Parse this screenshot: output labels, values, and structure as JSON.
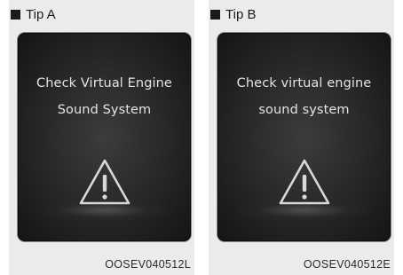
{
  "panels": [
    {
      "tip_label": "Tip A",
      "message_line1": "Check Virtual Engine",
      "message_line2": "Sound System",
      "icon": "warning-triangle-icon",
      "figure_code": "OOSEV040512L"
    },
    {
      "tip_label": "Tip B",
      "message_line1": "Check virtual engine",
      "message_line2": "sound system",
      "icon": "warning-triangle-icon",
      "figure_code": "OOSEV040512E"
    }
  ],
  "colors": {
    "panel_background": "#ebebeb",
    "screen_background": "#262626",
    "screen_text": "#e4e4e4"
  }
}
